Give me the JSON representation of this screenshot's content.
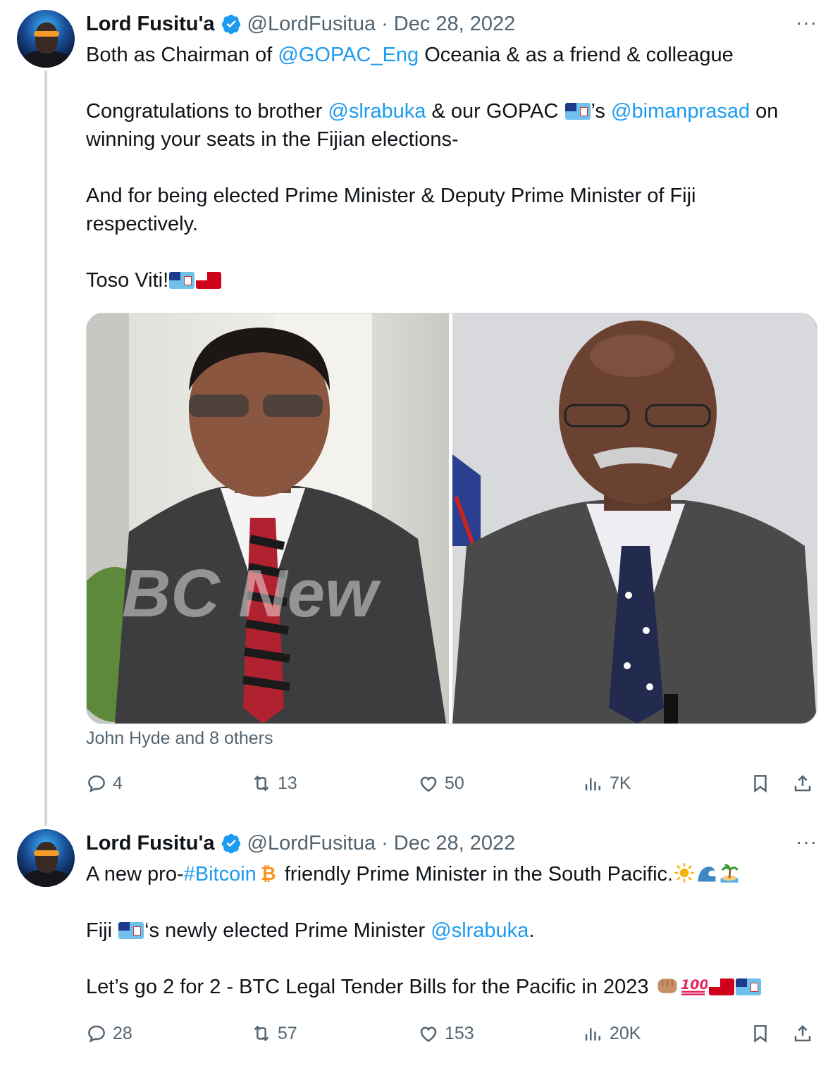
{
  "tweets": [
    {
      "author": "Lord Fusitu'a",
      "handle": "@LordFusitua",
      "separator": "·",
      "date": "Dec 28, 2022",
      "more": "···",
      "text": {
        "l1a": "Both as Chairman of ",
        "l1link": "@GOPAC_Eng",
        "l1b": " Oceania & as a friend & colleague",
        "l2a": "Congratulations to brother ",
        "l2link1": "@slrabuka",
        "l2b": " & our GOPAC ",
        "l2c": "’s ",
        "l2link2": "@bimanprasad",
        "l2d": " on",
        "l3": "winning your seats in the Fijian elections-",
        "l4": "And for being elected Prime Minister & Deputy Prime Minister of Fiji",
        "l5": "respectively.",
        "l6": "Toso Viti!"
      },
      "media_watermark": "BC New",
      "tagged": "John Hyde and 8 others",
      "stats": {
        "replies": "4",
        "retweets": "13",
        "likes": "50",
        "views": "7K"
      }
    },
    {
      "author": "Lord Fusitu'a",
      "handle": "@LordFusitua",
      "separator": "·",
      "date": "Dec 28, 2022",
      "more": "···",
      "text": {
        "l1a": "A new pro-",
        "l1link": "#Bitcoin",
        "l1b": " friendly Prime Minister in the South Pacific.",
        "l2a": "Fiji ",
        "l2b": "‘s newly elected Prime Minister ",
        "l2link": "@slrabuka",
        "l2c": ".",
        "l3": "Let’s go 2 for 2 - BTC Legal Tender Bills for the Pacific in 2023 "
      },
      "stats": {
        "replies": "28",
        "retweets": "57",
        "likes": "153",
        "views": "20K"
      }
    }
  ],
  "colors": {
    "link": "#1d9bf0",
    "secondary": "#536471",
    "verified": "#1d9bf0",
    "bitcoin": "#f7931a"
  },
  "icons": [
    "verified-badge-icon",
    "more-icon",
    "reply-icon",
    "retweet-icon",
    "like-icon",
    "views-icon",
    "bookmark-icon",
    "share-icon",
    "fiji-flag-icon",
    "tonga-flag-icon",
    "bitcoin-icon",
    "sun-icon",
    "wave-icon",
    "island-icon",
    "fist-icon",
    "hundred-icon"
  ]
}
